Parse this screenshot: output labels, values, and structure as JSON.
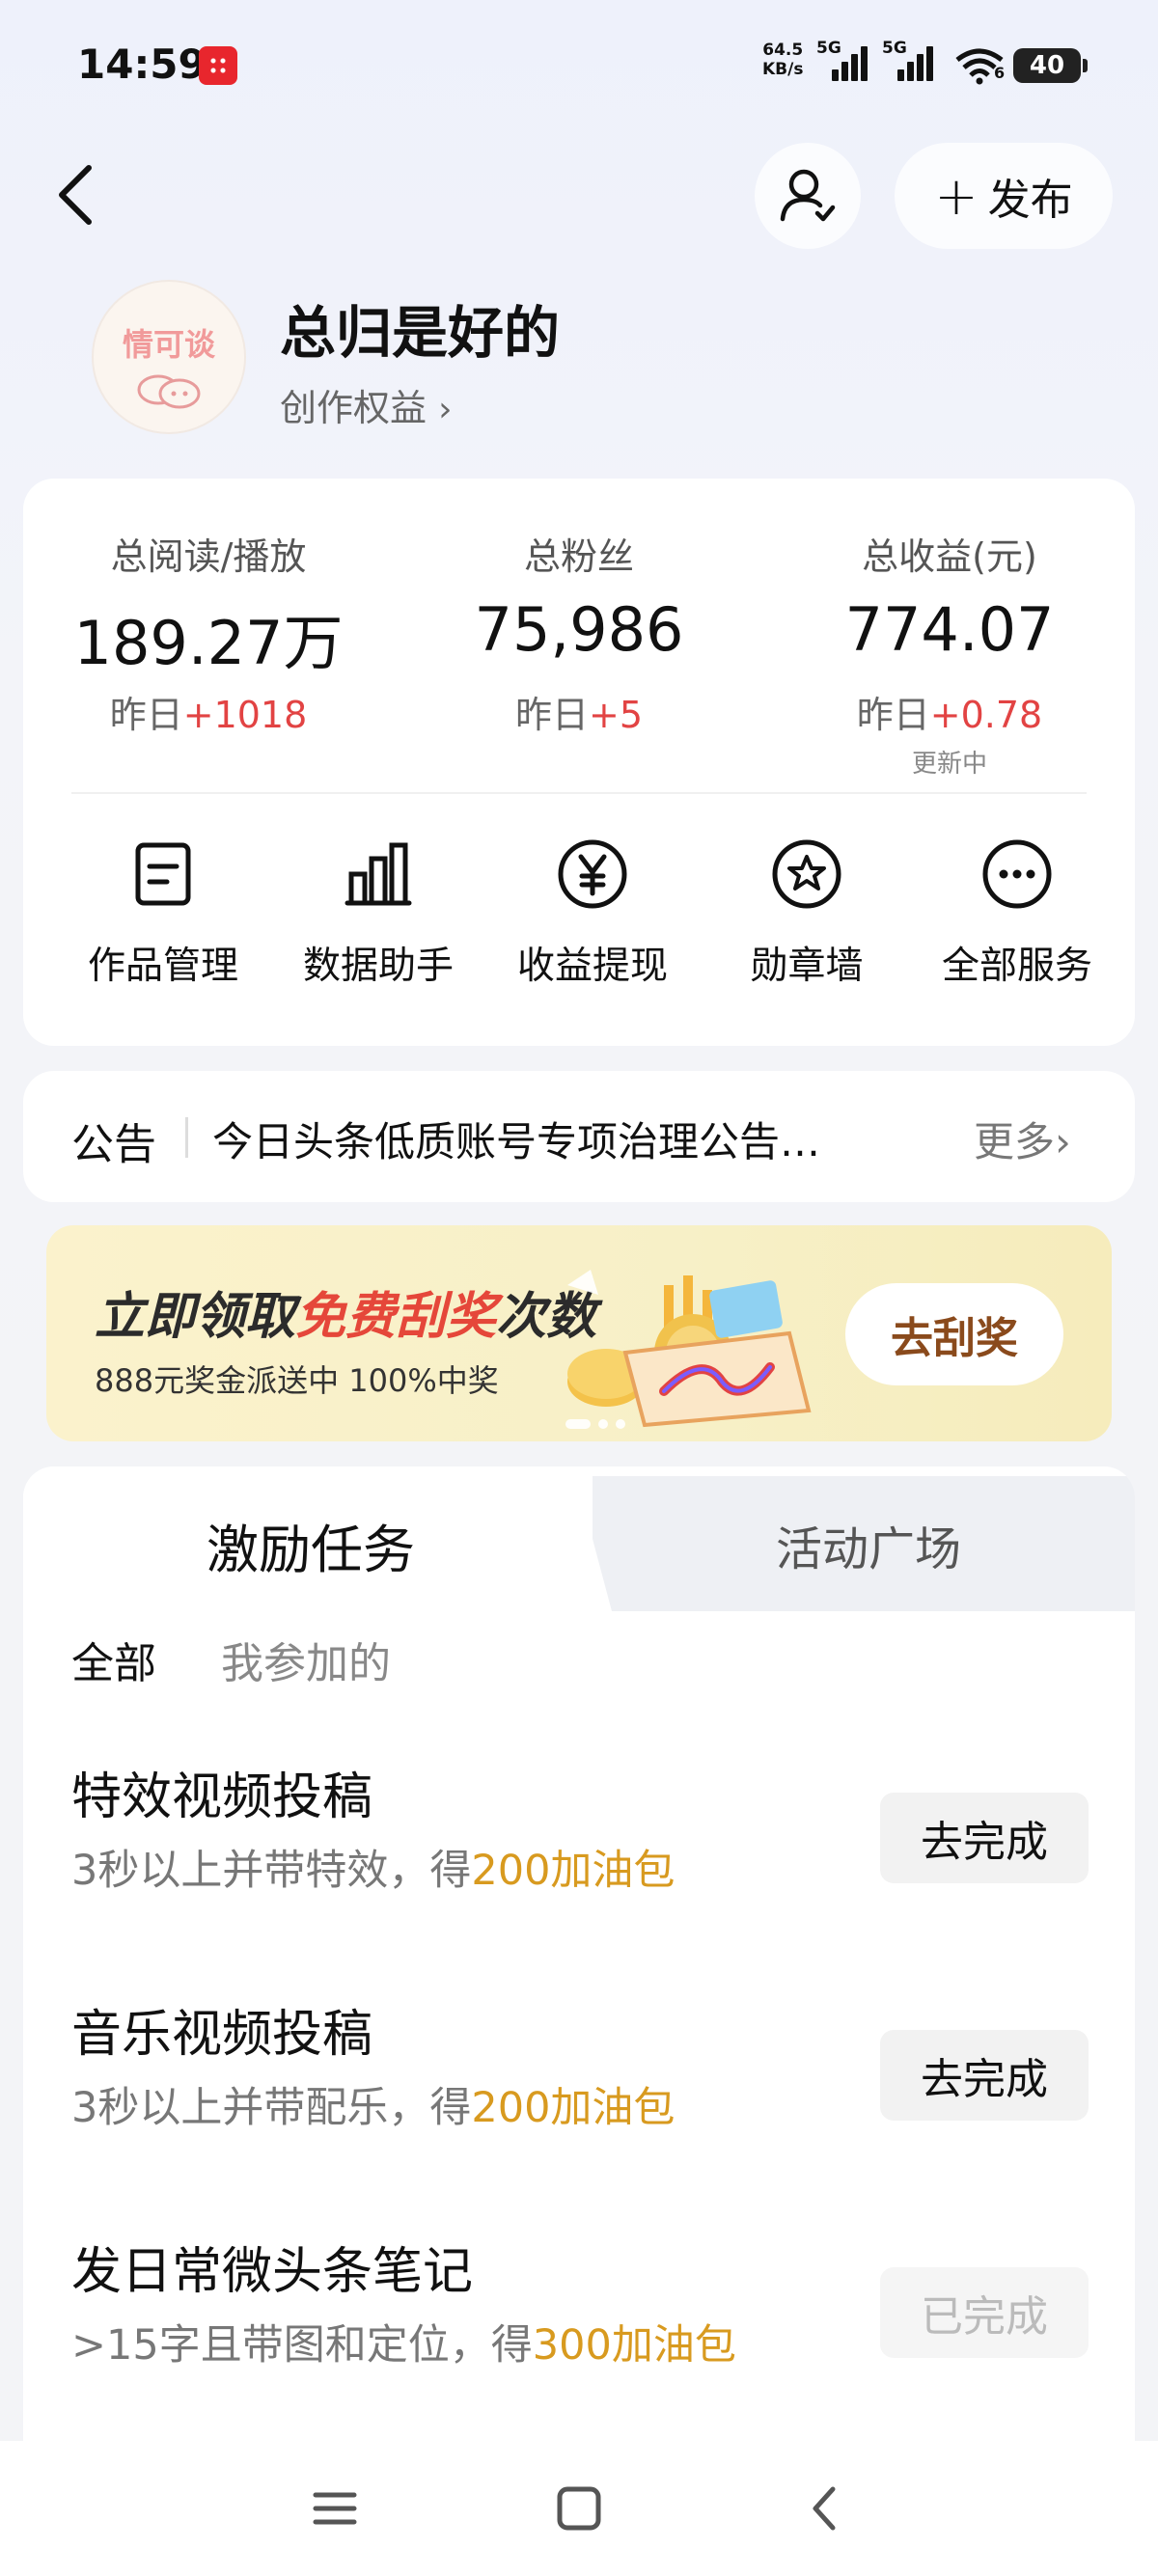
{
  "status_bar": {
    "time": "14:59",
    "net_speed_value": "64.5",
    "net_speed_unit": "KB/s",
    "network1": "5G",
    "network2": "5G",
    "wifi_sub": "6",
    "battery": "40"
  },
  "header": {
    "publish_label": "发布"
  },
  "profile": {
    "avatar_text": "情可谈",
    "username": "总归是好的",
    "rights_label": "创作权益"
  },
  "stats": [
    {
      "label": "总阅读/播放",
      "value": "189.27万",
      "delta_prefix": "昨日",
      "delta": "+1018"
    },
    {
      "label": "总粉丝",
      "value": "75,986",
      "delta_prefix": "昨日",
      "delta": "+5"
    },
    {
      "label": "总收益(元)",
      "value": "774.07",
      "delta_prefix": "昨日",
      "delta": "+0.78",
      "note": "更新中"
    }
  ],
  "services": [
    {
      "label": "作品管理",
      "icon": "document-icon"
    },
    {
      "label": "数据助手",
      "icon": "bar-chart-icon"
    },
    {
      "label": "收益提现",
      "icon": "yuan-icon"
    },
    {
      "label": "勋章墙",
      "icon": "medal-icon"
    },
    {
      "label": "全部服务",
      "icon": "more-icon"
    }
  ],
  "notice": {
    "title": "公告",
    "text": "今日头条低质账号专项治理公告…",
    "more": "更多"
  },
  "banner": {
    "title_a": "立即领取",
    "title_highlight": "免费刮奖",
    "title_b": "次数",
    "subtitle": "888元奖金派送中 100%中奖",
    "button": "去刮奖"
  },
  "tasks": {
    "tabs": [
      "激励任务",
      "活动广场"
    ],
    "filters": [
      "全部",
      "我参加的"
    ],
    "items": [
      {
        "title": "特效视频投稿",
        "desc": "3秒以上并带特效，得",
        "reward": "200加油包",
        "button": "去完成",
        "done": false
      },
      {
        "title": "音乐视频投稿",
        "desc": "3秒以上并带配乐，得",
        "reward": "200加油包",
        "button": "去完成",
        "done": false
      },
      {
        "title": "发日常微头条笔记",
        "desc": ">15字且带图和定位，得",
        "reward": "300加油包",
        "button": "已完成",
        "done": true
      }
    ]
  },
  "colors": {
    "accent_red": "#e24343",
    "reward_gold": "#d89a1f",
    "banner_bg": "#fbf2cc"
  }
}
